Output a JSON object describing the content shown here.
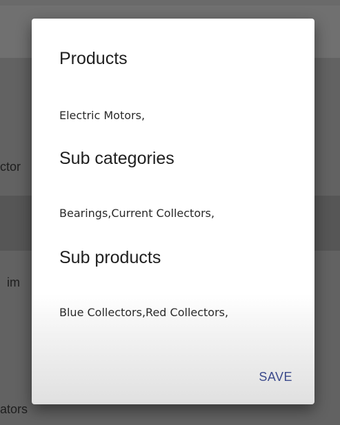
{
  "background": {
    "fragments": [
      "ctor",
      "im",
      "ators"
    ]
  },
  "dialog": {
    "sections": [
      {
        "title": "Products",
        "value": "Electric Motors,"
      },
      {
        "title": "Sub categories",
        "value": "Bearings,Current Collectors,"
      },
      {
        "title": "Sub products",
        "value": "Blue Collectors,Red Collectors,"
      }
    ],
    "save_label": "SAVE"
  }
}
